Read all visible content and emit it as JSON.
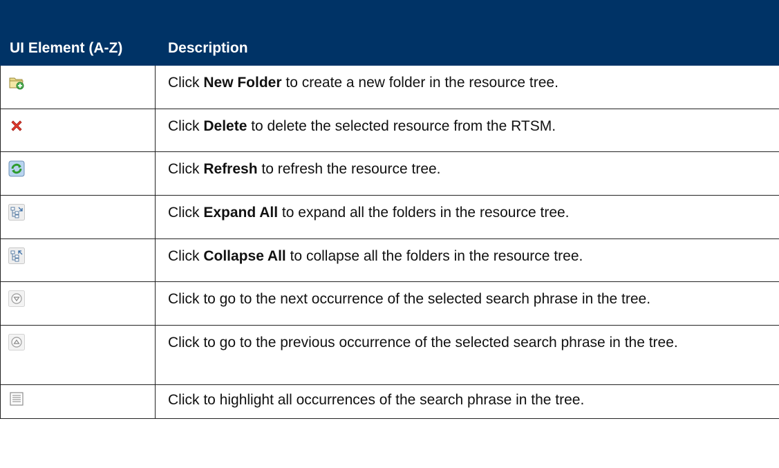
{
  "table": {
    "headers": {
      "element": "UI Element (A-Z)",
      "description": "Description"
    },
    "rows": [
      {
        "icon": "new-folder-icon",
        "pre": "Click ",
        "bold": "New Folder",
        "post": " to create a new folder in the resource tree."
      },
      {
        "icon": "delete-icon",
        "pre": "Click ",
        "bold": "Delete",
        "post": " to delete the selected resource from the RTSM."
      },
      {
        "icon": "refresh-icon",
        "pre": "Click ",
        "bold": "Refresh",
        "post": " to refresh the resource tree."
      },
      {
        "icon": "expand-all-icon",
        "pre": "Click ",
        "bold": "Expand All",
        "post": " to expand all the folders in the resource tree."
      },
      {
        "icon": "collapse-all-icon",
        "pre": "Click ",
        "bold": "Collapse All",
        "post": " to collapse all the folders in the resource tree."
      },
      {
        "icon": "next-occurrence-icon",
        "text": "Click to go to the next occurrence of the selected search phrase in the tree."
      },
      {
        "icon": "previous-occurrence-icon",
        "text": "Click to go to the previous occurrence of the selected search phrase in the tree."
      },
      {
        "icon": "highlight-all-icon",
        "text": "Click to highlight all occurrences of the search phrase in the tree."
      }
    ]
  },
  "colors": {
    "header_bg": "#003366",
    "header_text": "#ffffff",
    "border": "#222222"
  }
}
